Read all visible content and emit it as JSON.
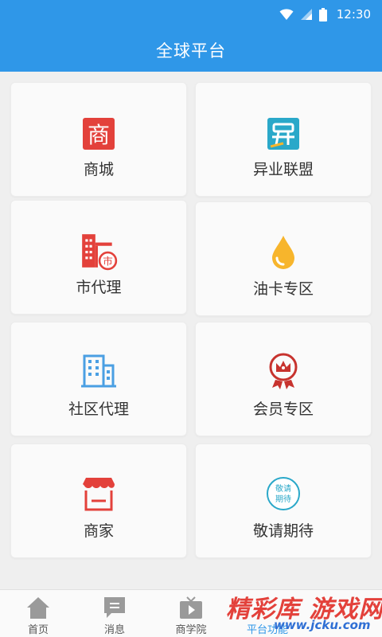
{
  "status_bar": {
    "time": "12:30",
    "icons": [
      "wifi-icon",
      "signal-icon",
      "battery-icon"
    ]
  },
  "header": {
    "title": "全球平台"
  },
  "grid": {
    "items": [
      {
        "label": "商城",
        "icon": "shop-badge-icon"
      },
      {
        "label": "异业联盟",
        "icon": "alliance-icon"
      },
      {
        "label": "市代理",
        "icon": "city-agent-icon"
      },
      {
        "label": "油卡专区",
        "icon": "oil-drop-icon"
      },
      {
        "label": "社区代理",
        "icon": "community-building-icon"
      },
      {
        "label": "会员专区",
        "icon": "member-crown-icon"
      },
      {
        "label": "商家",
        "icon": "storefront-icon"
      },
      {
        "label": "敬请期待",
        "icon": "coming-soon-icon"
      }
    ],
    "icon_texts": {
      "shop": "商",
      "city": "市",
      "coming_soon_line1": "敬请",
      "coming_soon_line2": "期待"
    }
  },
  "tabbar": {
    "tabs": [
      {
        "label": "首页",
        "icon": "home-icon"
      },
      {
        "label": "消息",
        "icon": "message-icon"
      },
      {
        "label": "商学院",
        "icon": "tv-play-icon"
      },
      {
        "label": "平台功能",
        "icon": "platform-icon"
      }
    ]
  },
  "watermark": {
    "text": "精彩库 游戏网",
    "url": "www.jcku.com"
  },
  "colors": {
    "primary": "#2f97e8",
    "red": "#e3413b",
    "orange": "#f7b52c",
    "blue_icon": "#4a9fe3",
    "teal": "#2aa8c9"
  }
}
